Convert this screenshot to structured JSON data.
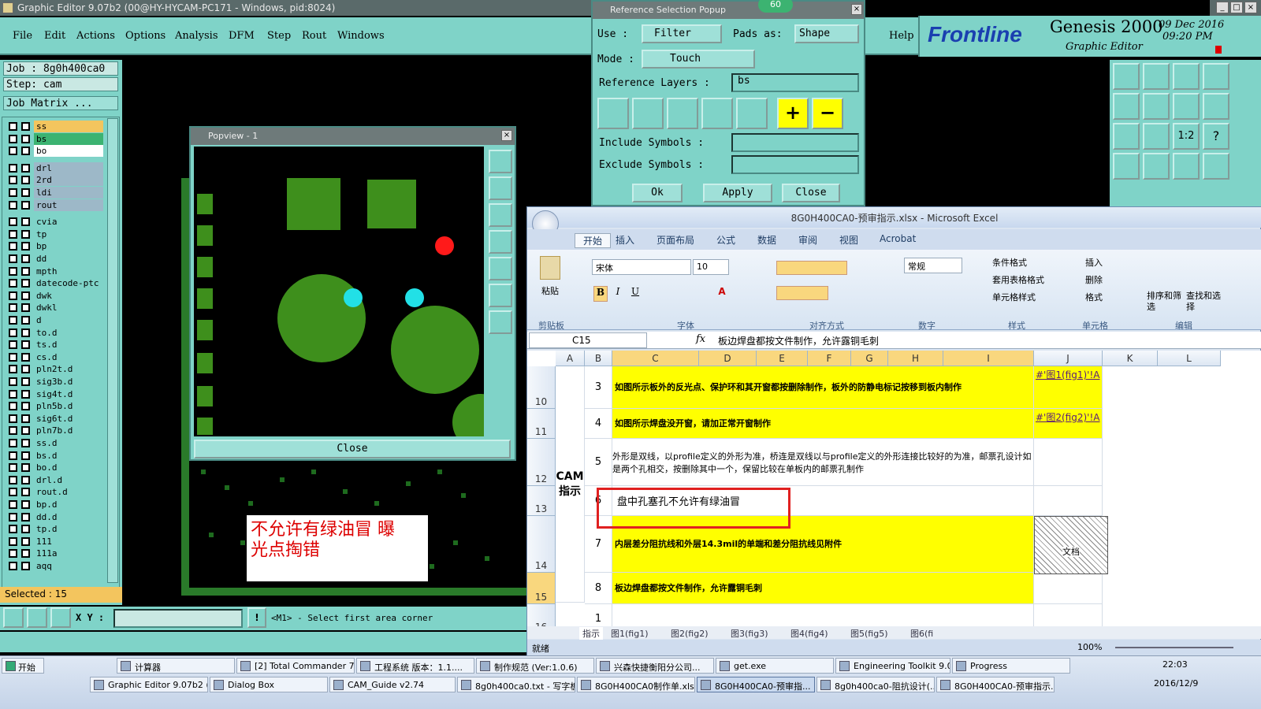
{
  "genesis": {
    "title": "Graphic Editor 9.07b2 (00@HY-HYCAM-PC171 - Windows, pid:8024)",
    "menus": [
      "File",
      "Edit",
      "Actions",
      "Options",
      "Analysis",
      "DFM",
      "Step",
      "Rout",
      "Windows"
    ],
    "help": "Help",
    "brand": "Frontline",
    "product": "Genesis 2000",
    "subtitle": "Graphic Editor",
    "date": "09 Dec 2016",
    "time": "09:20 PM",
    "job_label": "Job : 8g0h400ca0",
    "step_label": "Step: cam",
    "job_matrix": "Job Matrix ...",
    "layers": [
      "ss",
      "bs",
      "bo",
      "drl",
      "2rd",
      "ldi",
      "rout",
      "cvia",
      "tp",
      "bp",
      "dd",
      "mpth",
      "datecode-ptc",
      "dwk",
      "dwkl",
      "d",
      "to.d",
      "ts.d",
      "cs.d",
      "pln2t.d",
      "sig3b.d",
      "sig4t.d",
      "pln5b.d",
      "sig6t.d",
      "pln7b.d",
      "ss.d",
      "bs.d",
      "bo.d",
      "drl.d",
      "rout.d",
      "bp.d",
      "dd.d",
      "tp.d",
      "111",
      "111a",
      "aqq"
    ],
    "selected": "Selected : 15",
    "xy_label": "X Y :",
    "prompt": "<M1> - Select first area corner",
    "annotation_line1": "不允许有绿油冒   曝",
    "annotation_line2": "光点掏错"
  },
  "popup": {
    "title": "Reference Selection Popup",
    "badge": "60",
    "use_label": "Use   :",
    "use_value": "Filter",
    "pads_label": "Pads as:",
    "pads_value": "Shape",
    "mode_label": "Mode  :",
    "mode_value": "Touch",
    "ref_layers_label": "Reference Layers :",
    "ref_layers_value": "bs",
    "include_label": "Include Symbols :",
    "exclude_label": "Exclude Symbols :",
    "ok": "Ok",
    "apply": "Apply",
    "close": "Close"
  },
  "popview": {
    "title": "Popview - 1",
    "close": "Close"
  },
  "excel": {
    "title": "8G0H400CA0-预审指示.xlsx - Microsoft Excel",
    "tabs": [
      "开始",
      "插入",
      "页面布局",
      "公式",
      "数据",
      "审阅",
      "视图",
      "Acrobat"
    ],
    "paste": "粘贴",
    "font_name": "宋体",
    "font_size": "10",
    "number_format": "常规",
    "styles": [
      "条件格式",
      "套用表格格式",
      "单元格样式"
    ],
    "cells_cmds": [
      "插入",
      "删除",
      "格式"
    ],
    "edit_cmds": [
      "排序和筛选",
      "查找和选择"
    ],
    "groups": [
      "剪贴板",
      "字体",
      "对齐方式",
      "数字",
      "样式",
      "单元格",
      "编辑"
    ],
    "name_box": "C15",
    "formula": "板边焊盘都按文件制作，允许露铜毛刺",
    "columns": [
      "A",
      "B",
      "C",
      "D",
      "E",
      "F",
      "G",
      "H",
      "I",
      "J",
      "K",
      "L"
    ],
    "rows": [
      {
        "num": "10",
        "b": "3",
        "c": "如图所示板外的反光点、保护环和其开窗都按删除制作，板外的防静电标记按移到板内制作",
        "j": "#'图1(fig1)'!A",
        "yellow": true
      },
      {
        "num": "11",
        "b": "4",
        "c": "如图所示焊盘没开窗，请加正常开窗制作",
        "j": "#'图2(fig2)'!A",
        "yellow": true
      },
      {
        "num": "12",
        "b": "5",
        "c": "外形是双线，以profile定义的外形为准，桥连是双线以与profile定义的外形连接比较好的为准，邮票孔设计如是两个孔相交，按删除其中一个，保留比较在单板内的邮票孔制作",
        "j": "",
        "yellow": false
      },
      {
        "num": "13",
        "b": "6",
        "c": "盘中孔塞孔不允许有绿油冒",
        "j": "",
        "yellow": false
      },
      {
        "num": "14",
        "b": "7",
        "c": "内层差分阻抗线和外层14.3mil的单端和差分阻抗线见附件",
        "j": "",
        "yellow": true
      },
      {
        "num": "15",
        "b": "8",
        "c": "板边焊盘都按文件制作，允许露铜毛刺",
        "j": "",
        "yellow": true
      },
      {
        "num": "16",
        "b": "1",
        "c": "",
        "j": "",
        "yellow": false
      }
    ],
    "section_label": "CAM指示",
    "attachment": "文档",
    "sheets": [
      "指示",
      "图1(fig1)",
      "图2(fig2)",
      "图3(fig3)",
      "图4(fig4)",
      "图5(fig5)",
      "图6(fi"
    ],
    "status": "就绪",
    "zoom": "100%"
  },
  "taskbar": {
    "start": "开始",
    "row1": [
      "计算器",
      "[2] Total Commander 7...",
      "工程系统  版本：1.1....",
      "制作规范 (Ver:1.0.6)",
      "兴森快捷衡阳分公司...",
      "get.exe",
      "Engineering Toolkit 9.0...",
      "Progress"
    ],
    "row2": [
      "Graphic Editor 9.07b2 (0...",
      "Dialog Box",
      "CAM_Guide v2.74",
      "8g0h400ca0.txt - 写字板",
      "8G0H400CA0制作单.xls...",
      "8G0H400CA0-预审指...",
      "8g0h400ca0-阻抗设计(...",
      "8G0H400CA0-预审指示..."
    ],
    "clock_time": "22:03",
    "clock_date": "2016/12/9"
  }
}
